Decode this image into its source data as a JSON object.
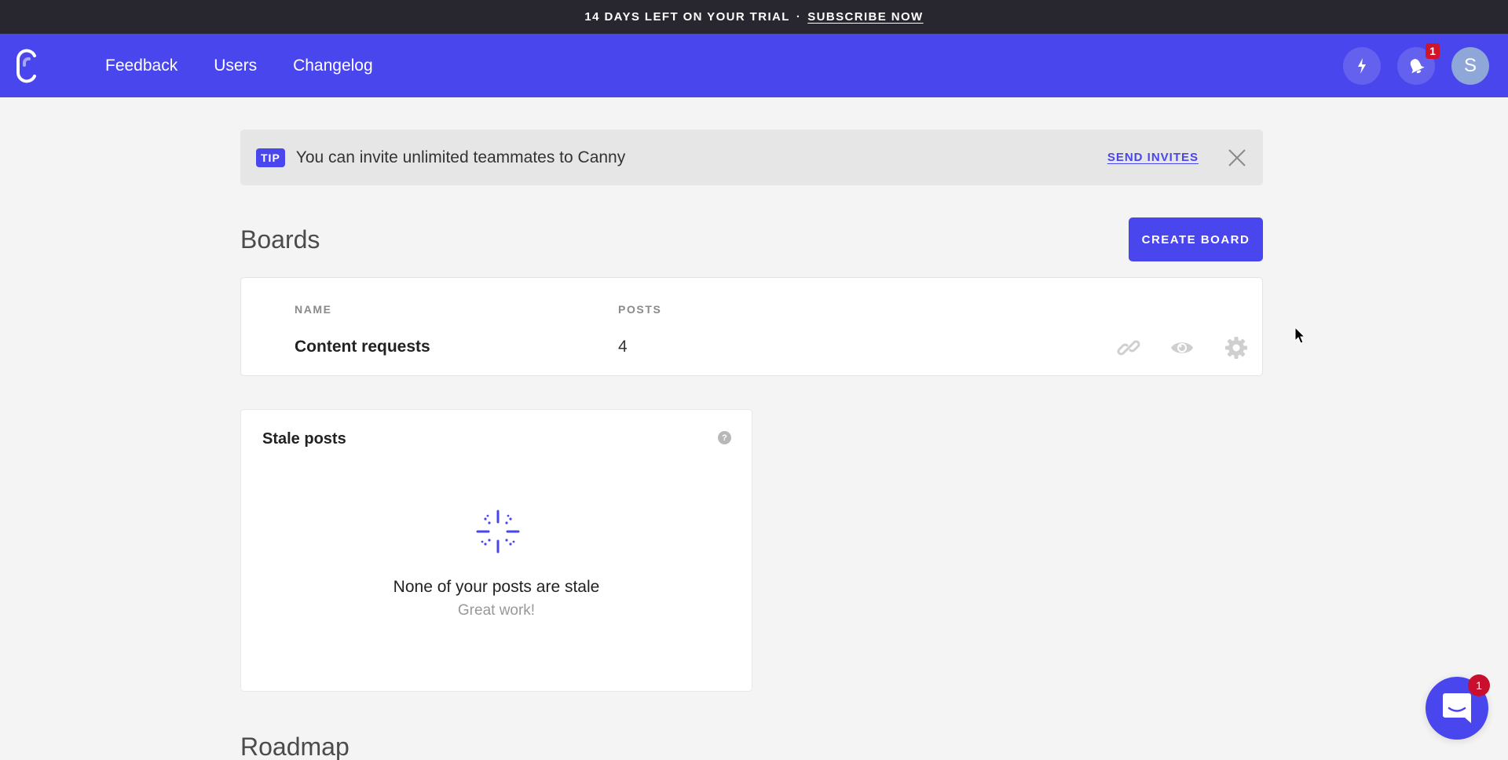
{
  "trial_banner": {
    "message": "14 DAYS LEFT ON YOUR TRIAL",
    "separator": "·",
    "cta_label": "SUBSCRIBE NOW"
  },
  "navbar": {
    "logo_icon": "canny-logo",
    "links": [
      {
        "label": "Feedback"
      },
      {
        "label": "Users"
      },
      {
        "label": "Changelog"
      }
    ],
    "actions": [
      {
        "icon": "lightning-icon"
      },
      {
        "icon": "bell-icon",
        "badge": "1"
      }
    ],
    "avatar_initial": "S"
  },
  "tip": {
    "badge": "TIP",
    "text": "You can invite unlimited teammates to Canny",
    "action_label": "SEND INVITES",
    "close_icon": "close-icon"
  },
  "boards": {
    "title": "Boards",
    "create_label": "CREATE BOARD",
    "columns": [
      "NAME",
      "POSTS"
    ],
    "rows": [
      {
        "name": "Content requests",
        "posts": "4",
        "actions": [
          "link-icon",
          "eye-icon",
          "gear-icon"
        ]
      }
    ]
  },
  "stale_posts": {
    "title": "Stale posts",
    "help_label": "?",
    "empty_message": "None of your posts are stale",
    "empty_sub": "Great work!"
  },
  "roadmap": {
    "title": "Roadmap"
  },
  "chat": {
    "badge": "1"
  },
  "colors": {
    "brand": "#4a46ed",
    "banner_bg": "#28262f",
    "page_bg": "#f4f4f4",
    "badge_red": "#d0142a"
  }
}
